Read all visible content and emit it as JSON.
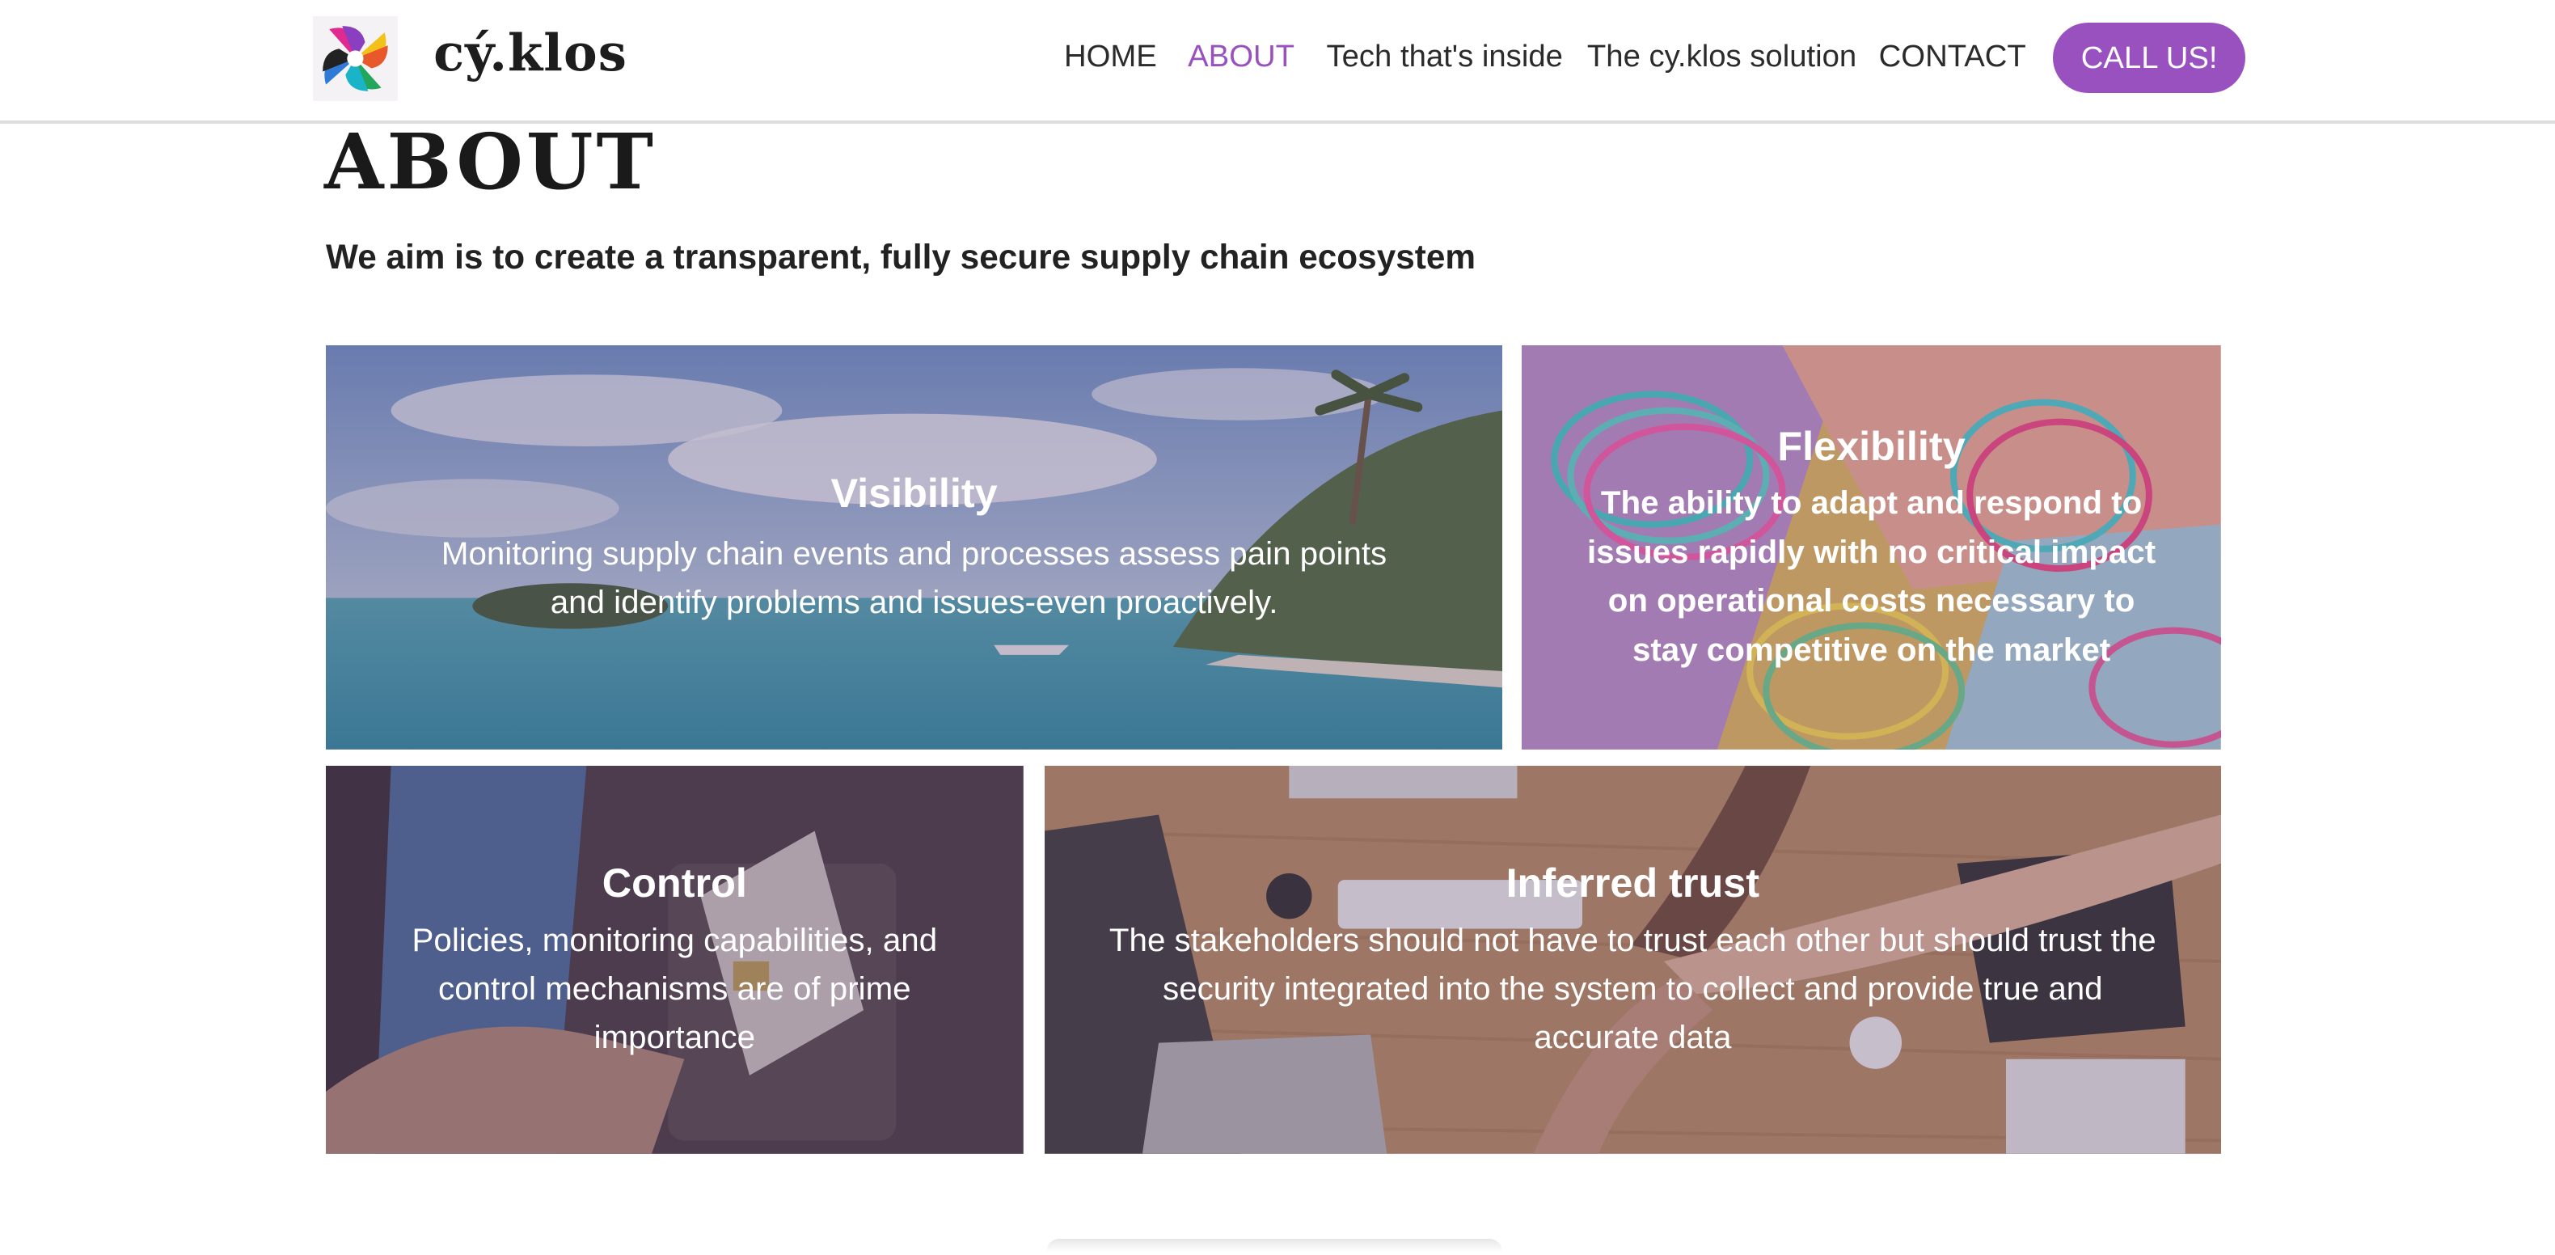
{
  "brand": {
    "name": "cý.klos"
  },
  "nav": {
    "items": [
      {
        "label": "HOME",
        "active": false
      },
      {
        "label": "ABOUT",
        "active": true
      },
      {
        "label": "Tech that's inside",
        "active": false
      },
      {
        "label": "The cy.klos solution",
        "active": false
      },
      {
        "label": "CONTACT",
        "active": false
      }
    ],
    "cta": "CALL US!"
  },
  "page": {
    "title": "ABOUT",
    "subtitle": "We aim is to create a transparent, fully secure supply chain ecosystem"
  },
  "cards": [
    {
      "title": "Visibility",
      "text": "Monitoring supply chain events and processes assess pain points and identify problems and issues-even proactively.",
      "image": "tropical-beach-photo"
    },
    {
      "title": "Flexibility",
      "text": "The ability to adapt and respond to issues rapidly with no critical impact on operational costs necessary to stay competitive on the market",
      "image": "colorful-spring-toys-photo"
    },
    {
      "title": "Control",
      "text": "Policies, monitoring capabilities, and control mechanisms are of prime importance",
      "image": "card-payment-terminal-photo"
    },
    {
      "title": "Inferred trust",
      "text": "The stakeholders should not have to trust each other but should trust the security integrated into the system to collect and provide true and accurate data",
      "image": "team-hands-desk-photo"
    }
  ],
  "colors": {
    "accent": "#9a51c0",
    "overlay": "#5a3a6a"
  }
}
